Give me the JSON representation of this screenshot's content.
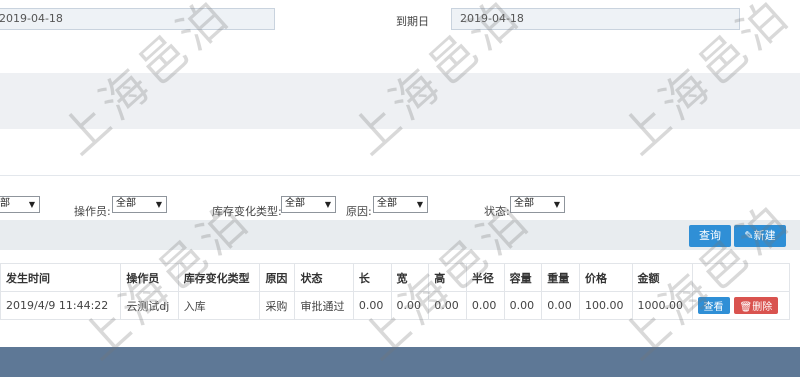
{
  "dates": {
    "start_value": "2019-04-18",
    "due_label": "到期日",
    "due_value": "2019-04-18"
  },
  "filters": {
    "first_select": "部",
    "operator_label": "操作员:",
    "operator_value": "全部",
    "change_type_label": "库存变化类型:",
    "change_type_value": "全部",
    "reason_label": "原因:",
    "reason_value": "全部",
    "status_label": "状态:",
    "status_value": "全部"
  },
  "toolbar": {
    "query_label": "查询",
    "new_label": "新建"
  },
  "table": {
    "headers": [
      "发生时间",
      "操作员",
      "库存变化类型",
      "原因",
      "状态",
      "长",
      "宽",
      "高",
      "半径",
      "容量",
      "重量",
      "价格",
      "金额",
      ""
    ],
    "rows": [
      {
        "time": "2019/4/9 11:44:22",
        "operator": "云测试dj",
        "change_type": "入库",
        "reason": "采购",
        "status": "审批通过",
        "length": "0.00",
        "width": "0.00",
        "height": "0.00",
        "radius": "0.00",
        "capacity": "0.00",
        "weight": "0.00",
        "price": "100.00",
        "amount": "1000.00",
        "view_label": "查看",
        "delete_label": "删除"
      }
    ]
  },
  "watermark": "上海邑泊"
}
